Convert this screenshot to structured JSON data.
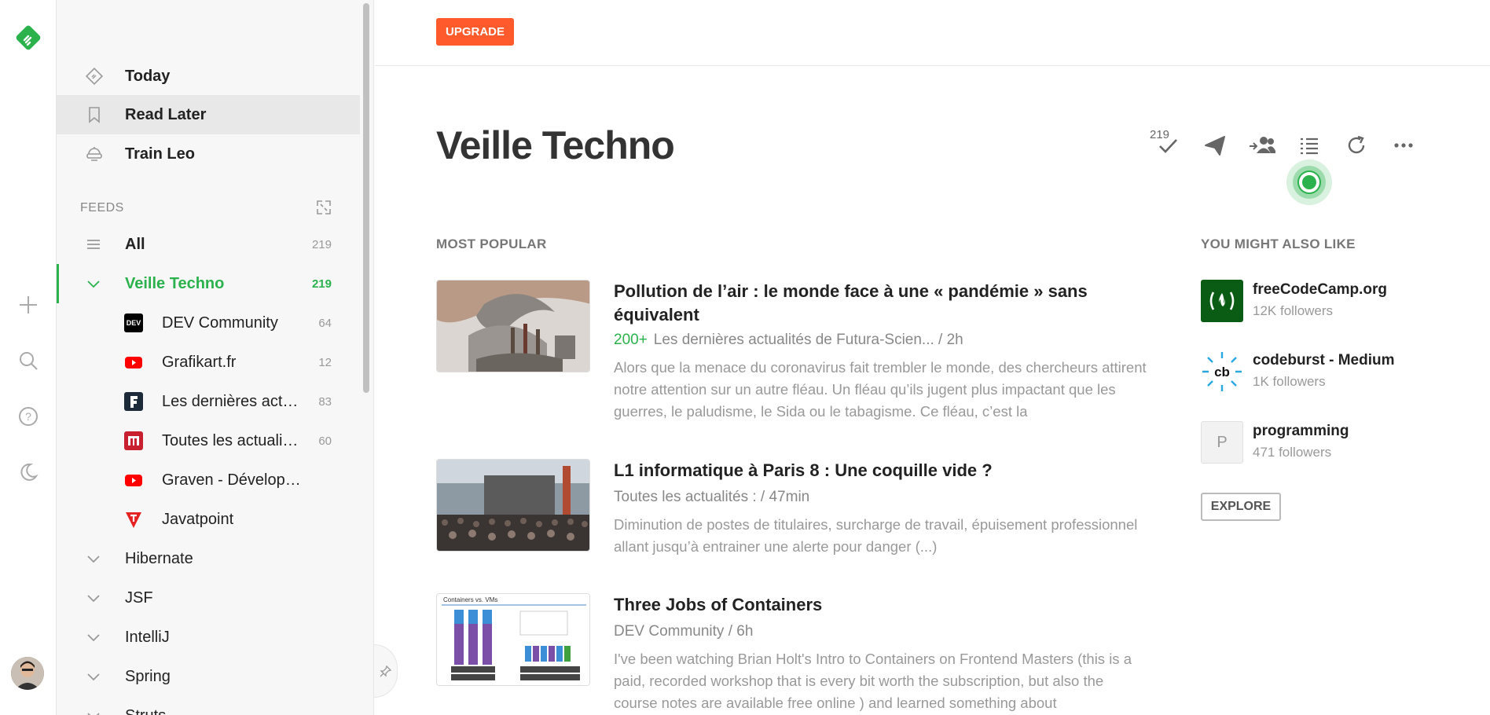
{
  "rail": {
    "icons": [
      "feedly-logo",
      "plus-icon",
      "search-icon",
      "help-icon",
      "moon-icon"
    ]
  },
  "sidebar": {
    "nav": [
      {
        "label": "Today",
        "icon": "today-icon"
      },
      {
        "label": "Read Later",
        "icon": "bookmark-icon"
      },
      {
        "label": "Train Leo",
        "icon": "leo-icon"
      }
    ],
    "feeds_header": "FEEDS",
    "all": {
      "label": "All",
      "count": "219"
    },
    "current": {
      "label": "Veille Techno",
      "count": "219"
    },
    "sources": [
      {
        "label": "DEV Community",
        "count": "64"
      },
      {
        "label": "Grafikart.fr",
        "count": "12"
      },
      {
        "label": "Les dernières act…",
        "count": "83"
      },
      {
        "label": "Toutes les actualit…",
        "count": "60"
      },
      {
        "label": "Graven - Dévelop…",
        "count": ""
      },
      {
        "label": "Javatpoint",
        "count": ""
      }
    ],
    "folders": [
      "Hibernate",
      "JSF",
      "IntelliJ",
      "Spring",
      "Struts"
    ]
  },
  "topbar": {
    "upgrade_label": "UPGRADE"
  },
  "main": {
    "title": "Veille Techno",
    "unread_count": "219",
    "most_popular_label": "MOST POPULAR",
    "articles": [
      {
        "title": "Pollution de l’air : le monde face à une « pandémie » sans équivalent",
        "hot": "200+",
        "meta": "Les dernières actualités de Futura-Scien... / 2h",
        "snippet": "Alors que la menace du coronavirus fait trembler le monde, des chercheurs attirent notre attention sur un autre fléau. Un fléau qu’ils jugent plus impactant que les guerres, le paludisme, le Sida ou le tabagisme. Ce fléau, c’est la"
      },
      {
        "title": "L1 informatique à Paris 8 : Une coquille vide ?",
        "meta": "Toutes les actualités : / 47min",
        "snippet": "Diminution de postes de titulaires, surcharge de travail, épuisement professionnel allant jusqu’à entrainer une alerte pour danger (...)"
      },
      {
        "title": "Three Jobs of Containers",
        "meta": "DEV Community / 6h",
        "thumb_caption": "Containers vs. VMs",
        "snippet": "I've been watching Brian Holt's Intro to Containers on Frontend Masters (this is a paid, recorded workshop that is every bit worth the subscription, but also the course notes are available free online ) and learned something about"
      }
    ]
  },
  "suggestions": {
    "label": "YOU MIGHT ALSO LIKE",
    "items": [
      {
        "name": "freeCodeCamp.org",
        "followers": "12K followers",
        "icon_text": "(🔥)"
      },
      {
        "name": "codeburst - Medium",
        "followers": "1K followers",
        "icon_text": "cb"
      },
      {
        "name": "programming",
        "followers": "471 followers",
        "icon_text": "P"
      }
    ],
    "explore_label": "EXPLORE"
  },
  "colors": {
    "accent": "#2bb24c",
    "upgrade": "#ff5a2c"
  }
}
